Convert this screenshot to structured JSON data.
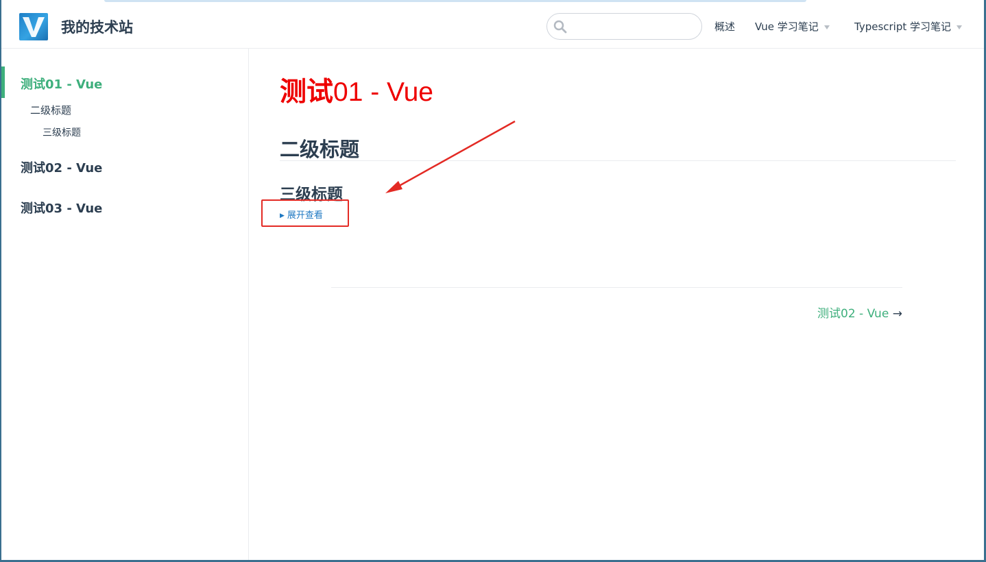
{
  "site": {
    "name": "我的技术站",
    "logo_letter": "V"
  },
  "search": {
    "placeholder": "",
    "value": ""
  },
  "nav": {
    "overview": "概述",
    "vue_notes": "Vue 学习笔记",
    "ts_notes": "Typescript 学习笔记"
  },
  "sidebar": {
    "groups": [
      {
        "label": "测试01 - Vue",
        "active": true,
        "children": [
          {
            "label": "二级标题",
            "children": [
              {
                "label": "三级标题"
              }
            ]
          }
        ]
      },
      {
        "label": "测试02 - Vue",
        "active": false
      },
      {
        "label": "测试03 - Vue",
        "active": false
      }
    ]
  },
  "page": {
    "h1_bold": "测试",
    "h1_rest": "01 - Vue",
    "h2": "二级标题",
    "h3": "三级标题",
    "details_summary": "展开查看",
    "next_link": "测试02 - Vue",
    "next_arrow": "→"
  },
  "colors": {
    "accent": "#3eaf7c",
    "heading_red": "#ee0000",
    "annotation_red": "#e32a24",
    "summary_blue": "#1e78c2",
    "text": "#2c3e50"
  }
}
